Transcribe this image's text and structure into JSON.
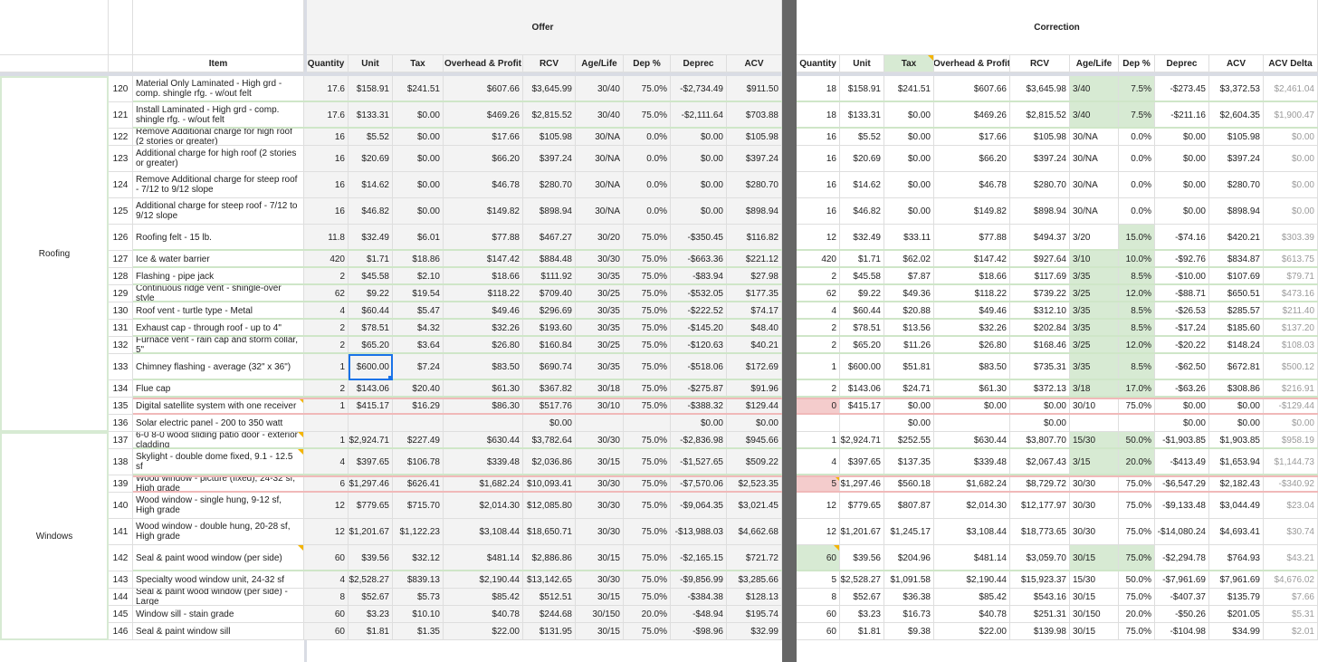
{
  "sections": {
    "offer": "Offer",
    "correction": "Correction"
  },
  "headers": {
    "item": "Item",
    "offer": [
      "Quantity",
      "Unit",
      "Tax",
      "Overhead & Profit",
      "RCV",
      "Age/Life",
      "Dep %",
      "Deprec",
      "ACV"
    ],
    "correction": [
      "Quantity",
      "Unit",
      "Tax",
      "Overhead & Profit",
      "RCV",
      "Age/Life",
      "Dep %",
      "Deprec",
      "ACV",
      "ACV Delta"
    ]
  },
  "groups": [
    {
      "label": "Roofing",
      "first": 0,
      "last": 16
    },
    {
      "label": "Windows",
      "first": 17,
      "last": 26
    }
  ],
  "colors": {
    "changed": "#d7ead3",
    "reduced": "#f4cccc",
    "divider": "#666666",
    "selection": "#1a73e8",
    "note": "#f4b400"
  },
  "rows": [
    {
      "num": "120",
      "item": "Material Only Laminated - High grd - comp. shingle rfg. - w/out felt",
      "offer": [
        "17.6",
        "$158.91",
        "$241.51",
        "$607.66",
        "$3,645.99",
        "30/40",
        "75.0%",
        "-$2,734.49",
        "$911.50"
      ],
      "corr": [
        "18",
        "$158.91",
        "$241.51",
        "$607.66",
        "$3,645.98",
        "3/40",
        "7.5%",
        "-$273.45",
        "$3,372.53",
        "$2,461.04"
      ]
    },
    {
      "num": "121",
      "item": "Install Laminated - High grd - comp. shingle rfg. - w/out felt",
      "offer": [
        "17.6",
        "$133.31",
        "$0.00",
        "$469.26",
        "$2,815.52",
        "30/40",
        "75.0%",
        "-$2,111.64",
        "$703.88"
      ],
      "corr": [
        "18",
        "$133.31",
        "$0.00",
        "$469.26",
        "$2,815.52",
        "3/40",
        "7.5%",
        "-$211.16",
        "$2,604.35",
        "$1,900.47"
      ]
    },
    {
      "num": "122",
      "item": "Remove Additional charge for high roof (2 stories or greater)",
      "offer": [
        "16",
        "$5.52",
        "$0.00",
        "$17.66",
        "$105.98",
        "30/NA",
        "0.0%",
        "$0.00",
        "$105.98"
      ],
      "corr": [
        "16",
        "$5.52",
        "$0.00",
        "$17.66",
        "$105.98",
        "30/NA",
        "0.0%",
        "$0.00",
        "$105.98",
        "$0.00"
      ]
    },
    {
      "num": "123",
      "item": "Additional charge for high roof (2 stories or greater)",
      "offer": [
        "16",
        "$20.69",
        "$0.00",
        "$66.20",
        "$397.24",
        "30/NA",
        "0.0%",
        "$0.00",
        "$397.24"
      ],
      "corr": [
        "16",
        "$20.69",
        "$0.00",
        "$66.20",
        "$397.24",
        "30/NA",
        "0.0%",
        "$0.00",
        "$397.24",
        "$0.00"
      ]
    },
    {
      "num": "124",
      "item": "Remove Additional charge for steep roof - 7/12 to 9/12 slope",
      "offer": [
        "16",
        "$14.62",
        "$0.00",
        "$46.78",
        "$280.70",
        "30/NA",
        "0.0%",
        "$0.00",
        "$280.70"
      ],
      "corr": [
        "16",
        "$14.62",
        "$0.00",
        "$46.78",
        "$280.70",
        "30/NA",
        "0.0%",
        "$0.00",
        "$280.70",
        "$0.00"
      ]
    },
    {
      "num": "125",
      "item": "Additional charge for steep roof - 7/12 to 9/12 slope",
      "offer": [
        "16",
        "$46.82",
        "$0.00",
        "$149.82",
        "$898.94",
        "30/NA",
        "0.0%",
        "$0.00",
        "$898.94"
      ],
      "corr": [
        "16",
        "$46.82",
        "$0.00",
        "$149.82",
        "$898.94",
        "30/NA",
        "0.0%",
        "$0.00",
        "$898.94",
        "$0.00"
      ]
    },
    {
      "num": "126",
      "item": "Roofing felt - 15 lb.",
      "offer": [
        "11.8",
        "$32.49",
        "$6.01",
        "$77.88",
        "$467.27",
        "30/20",
        "75.0%",
        "-$350.45",
        "$116.82"
      ],
      "corr": [
        "12",
        "$32.49",
        "$33.11",
        "$77.88",
        "$494.37",
        "3/20",
        "15.0%",
        "-$74.16",
        "$420.21",
        "$303.39"
      ]
    },
    {
      "num": "127",
      "item": "Ice & water barrier",
      "offer": [
        "420",
        "$1.71",
        "$18.86",
        "$147.42",
        "$884.48",
        "30/30",
        "75.0%",
        "-$663.36",
        "$221.12"
      ],
      "corr": [
        "420",
        "$1.71",
        "$62.02",
        "$147.42",
        "$927.64",
        "3/10",
        "10.0%",
        "-$92.76",
        "$834.87",
        "$613.75"
      ]
    },
    {
      "num": "128",
      "item": "Flashing - pipe jack",
      "offer": [
        "2",
        "$45.58",
        "$2.10",
        "$18.66",
        "$111.92",
        "30/35",
        "75.0%",
        "-$83.94",
        "$27.98"
      ],
      "corr": [
        "2",
        "$45.58",
        "$7.87",
        "$18.66",
        "$117.69",
        "3/35",
        "8.5%",
        "-$10.00",
        "$107.69",
        "$79.71"
      ]
    },
    {
      "num": "129",
      "item": "Continuous ridge vent - shingle-over style",
      "offer": [
        "62",
        "$9.22",
        "$19.54",
        "$118.22",
        "$709.40",
        "30/25",
        "75.0%",
        "-$532.05",
        "$177.35"
      ],
      "corr": [
        "62",
        "$9.22",
        "$49.36",
        "$118.22",
        "$739.22",
        "3/25",
        "12.0%",
        "-$88.71",
        "$650.51",
        "$473.16"
      ]
    },
    {
      "num": "130",
      "item": "Roof vent - turtle type - Metal",
      "offer": [
        "4",
        "$60.44",
        "$5.47",
        "$49.46",
        "$296.69",
        "30/35",
        "75.0%",
        "-$222.52",
        "$74.17"
      ],
      "corr": [
        "4",
        "$60.44",
        "$20.88",
        "$49.46",
        "$312.10",
        "3/35",
        "8.5%",
        "-$26.53",
        "$285.57",
        "$211.40"
      ]
    },
    {
      "num": "131",
      "item": "Exhaust cap - through roof - up to 4\"",
      "offer": [
        "2",
        "$78.51",
        "$4.32",
        "$32.26",
        "$193.60",
        "30/35",
        "75.0%",
        "-$145.20",
        "$48.40"
      ],
      "corr": [
        "2",
        "$78.51",
        "$13.56",
        "$32.26",
        "$202.84",
        "3/35",
        "8.5%",
        "-$17.24",
        "$185.60",
        "$137.20"
      ]
    },
    {
      "num": "132",
      "item": "Furnace vent - rain cap and storm collar, 5\"",
      "offer": [
        "2",
        "$65.20",
        "$3.64",
        "$26.80",
        "$160.84",
        "30/25",
        "75.0%",
        "-$120.63",
        "$40.21"
      ],
      "corr": [
        "2",
        "$65.20",
        "$11.26",
        "$26.80",
        "$168.46",
        "3/25",
        "12.0%",
        "-$20.22",
        "$148.24",
        "$108.03"
      ]
    },
    {
      "num": "133",
      "item": "Chimney flashing - average (32\" x 36\")",
      "offer": [
        "1",
        "$600.00",
        "$7.24",
        "$83.50",
        "$690.74",
        "30/35",
        "75.0%",
        "-$518.06",
        "$172.69"
      ],
      "corr": [
        "1",
        "$600.00",
        "$51.81",
        "$83.50",
        "$735.31",
        "3/35",
        "8.5%",
        "-$62.50",
        "$672.81",
        "$500.12"
      ]
    },
    {
      "num": "134",
      "item": "Flue cap",
      "offer": [
        "2",
        "$143.06",
        "$20.40",
        "$61.30",
        "$367.82",
        "30/18",
        "75.0%",
        "-$275.87",
        "$91.96"
      ],
      "corr": [
        "2",
        "$143.06",
        "$24.71",
        "$61.30",
        "$372.13",
        "3/18",
        "17.0%",
        "-$63.26",
        "$308.86",
        "$216.91"
      ]
    },
    {
      "num": "135",
      "item": "Digital satellite system with one receiver",
      "offer": [
        "1",
        "$415.17",
        "$16.29",
        "$86.30",
        "$517.76",
        "30/10",
        "75.0%",
        "-$388.32",
        "$129.44"
      ],
      "corr": [
        "0",
        "$415.17",
        "$0.00",
        "$0.00",
        "$0.00",
        "30/10",
        "75.0%",
        "$0.00",
        "$0.00",
        "-$129.44"
      ]
    },
    {
      "num": "136",
      "item": "Solar electric panel - 200 to 350 watt",
      "offer": [
        "",
        "",
        "",
        "",
        "$0.00",
        "",
        "",
        "$0.00",
        "$0.00"
      ],
      "corr": [
        "",
        "",
        "$0.00",
        "",
        "$0.00",
        "",
        "",
        "$0.00",
        "$0.00",
        "$0.00"
      ]
    },
    {
      "num": "137",
      "item": "6-0 8-0 wood sliding patio door - exterior cladding",
      "offer": [
        "1",
        "$2,924.71",
        "$227.49",
        "$630.44",
        "$3,782.64",
        "30/30",
        "75.0%",
        "-$2,836.98",
        "$945.66"
      ],
      "corr": [
        "1",
        "$2,924.71",
        "$252.55",
        "$630.44",
        "$3,807.70",
        "15/30",
        "50.0%",
        "-$1,903.85",
        "$1,903.85",
        "$958.19"
      ]
    },
    {
      "num": "138",
      "item": "Skylight - double dome fixed, 9.1 - 12.5 sf",
      "offer": [
        "4",
        "$397.65",
        "$106.78",
        "$339.48",
        "$2,036.86",
        "30/15",
        "75.0%",
        "-$1,527.65",
        "$509.22"
      ],
      "corr": [
        "4",
        "$397.65",
        "$137.35",
        "$339.48",
        "$2,067.43",
        "3/15",
        "20.0%",
        "-$413.49",
        "$1,653.94",
        "$1,144.73"
      ]
    },
    {
      "num": "139",
      "item": "Wood window - picture (fixed), 24-32 sf, High grade",
      "offer": [
        "6",
        "$1,297.46",
        "$626.41",
        "$1,682.24",
        "$10,093.41",
        "30/30",
        "75.0%",
        "-$7,570.06",
        "$2,523.35"
      ],
      "corr": [
        "5",
        "$1,297.46",
        "$560.18",
        "$1,682.24",
        "$8,729.72",
        "30/30",
        "75.0%",
        "-$6,547.29",
        "$2,182.43",
        "-$340.92"
      ]
    },
    {
      "num": "140",
      "item": "Wood window - single hung, 9-12 sf, High grade",
      "offer": [
        "12",
        "$779.65",
        "$715.70",
        "$2,014.30",
        "$12,085.80",
        "30/30",
        "75.0%",
        "-$9,064.35",
        "$3,021.45"
      ],
      "corr": [
        "12",
        "$779.65",
        "$807.87",
        "$2,014.30",
        "$12,177.97",
        "30/30",
        "75.0%",
        "-$9,133.48",
        "$3,044.49",
        "$23.04"
      ]
    },
    {
      "num": "141",
      "item": "Wood window - double hung, 20-28 sf, High grade",
      "offer": [
        "12",
        "$1,201.67",
        "$1,122.23",
        "$3,108.44",
        "$18,650.71",
        "30/30",
        "75.0%",
        "-$13,988.03",
        "$4,662.68"
      ],
      "corr": [
        "12",
        "$1,201.67",
        "$1,245.17",
        "$3,108.44",
        "$18,773.65",
        "30/30",
        "75.0%",
        "-$14,080.24",
        "$4,693.41",
        "$30.74"
      ]
    },
    {
      "num": "142",
      "item": "Seal & paint wood window (per side)",
      "offer": [
        "60",
        "$39.56",
        "$32.12",
        "$481.14",
        "$2,886.86",
        "30/15",
        "75.0%",
        "-$2,165.15",
        "$721.72"
      ],
      "corr": [
        "60",
        "$39.56",
        "$204.96",
        "$481.14",
        "$3,059.70",
        "30/15",
        "75.0%",
        "-$2,294.78",
        "$764.93",
        "$43.21"
      ]
    },
    {
      "num": "143",
      "item": "Specialty wood window unit, 24-32 sf",
      "offer": [
        "4",
        "$2,528.27",
        "$839.13",
        "$2,190.44",
        "$13,142.65",
        "30/30",
        "75.0%",
        "-$9,856.99",
        "$3,285.66"
      ],
      "corr": [
        "5",
        "$2,528.27",
        "$1,091.58",
        "$2,190.44",
        "$15,923.37",
        "15/30",
        "50.0%",
        "-$7,961.69",
        "$7,961.69",
        "$4,676.02"
      ]
    },
    {
      "num": "144",
      "item": "Seal & paint wood window (per side) - Large",
      "offer": [
        "8",
        "$52.67",
        "$5.73",
        "$85.42",
        "$512.51",
        "30/15",
        "75.0%",
        "-$384.38",
        "$128.13"
      ],
      "corr": [
        "8",
        "$52.67",
        "$36.38",
        "$85.42",
        "$543.16",
        "30/15",
        "75.0%",
        "-$407.37",
        "$135.79",
        "$7.66"
      ]
    },
    {
      "num": "145",
      "item": "Window sill - stain grade",
      "offer": [
        "60",
        "$3.23",
        "$10.10",
        "$40.78",
        "$244.68",
        "30/150",
        "20.0%",
        "-$48.94",
        "$195.74"
      ],
      "corr": [
        "60",
        "$3.23",
        "$16.73",
        "$40.78",
        "$251.31",
        "30/150",
        "20.0%",
        "-$50.26",
        "$201.05",
        "$5.31"
      ]
    },
    {
      "num": "146",
      "item": "Seal & paint window sill",
      "offer": [
        "60",
        "$1.81",
        "$1.35",
        "$22.00",
        "$131.95",
        "30/15",
        "75.0%",
        "-$98.96",
        "$32.99"
      ],
      "corr": [
        "60",
        "$1.81",
        "$9.38",
        "$22.00",
        "$139.98",
        "30/15",
        "75.0%",
        "-$104.98",
        "$34.99",
        "$2.01"
      ]
    }
  ]
}
